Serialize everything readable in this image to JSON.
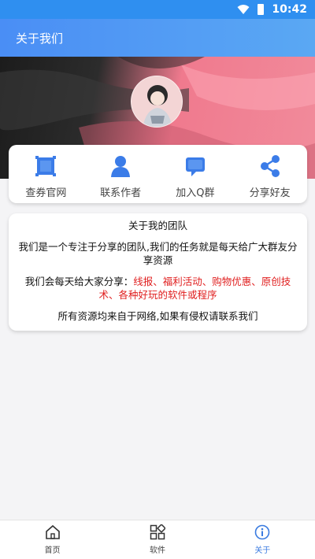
{
  "status_bar": {
    "time": "10:42"
  },
  "app_bar": {
    "title": "关于我们"
  },
  "quick_actions": [
    {
      "label": "查券官网",
      "icon": "coupon-site-icon"
    },
    {
      "label": "联系作者",
      "icon": "contact-author-icon"
    },
    {
      "label": "加入Q群",
      "icon": "join-qq-group-icon"
    },
    {
      "label": "分享好友",
      "icon": "share-icon"
    }
  ],
  "info": {
    "title": "关于我的团队",
    "paragraph1": "我们是一个专注于分享的团队,我们的任务就是每天给广大群友分享资源",
    "paragraph2_prefix": "我们会每天给大家分享：",
    "paragraph2_highlight": "线报、福利活动、购物优惠、原创技术、各种好玩的软件或程序",
    "paragraph3": "所有资源均来自于网络,如果有侵权请联系我们"
  },
  "bottom_nav": [
    {
      "label": "首页",
      "icon": "home-icon",
      "active": false
    },
    {
      "label": "软件",
      "icon": "apps-grid-icon",
      "active": false
    },
    {
      "label": "关于",
      "icon": "info-icon",
      "active": true
    }
  ],
  "colors": {
    "app_bar": "#4a8ef5",
    "accent_blue": "#3a7be0",
    "highlight_red": "#e02020",
    "hero_pink": "#f07a8e"
  }
}
